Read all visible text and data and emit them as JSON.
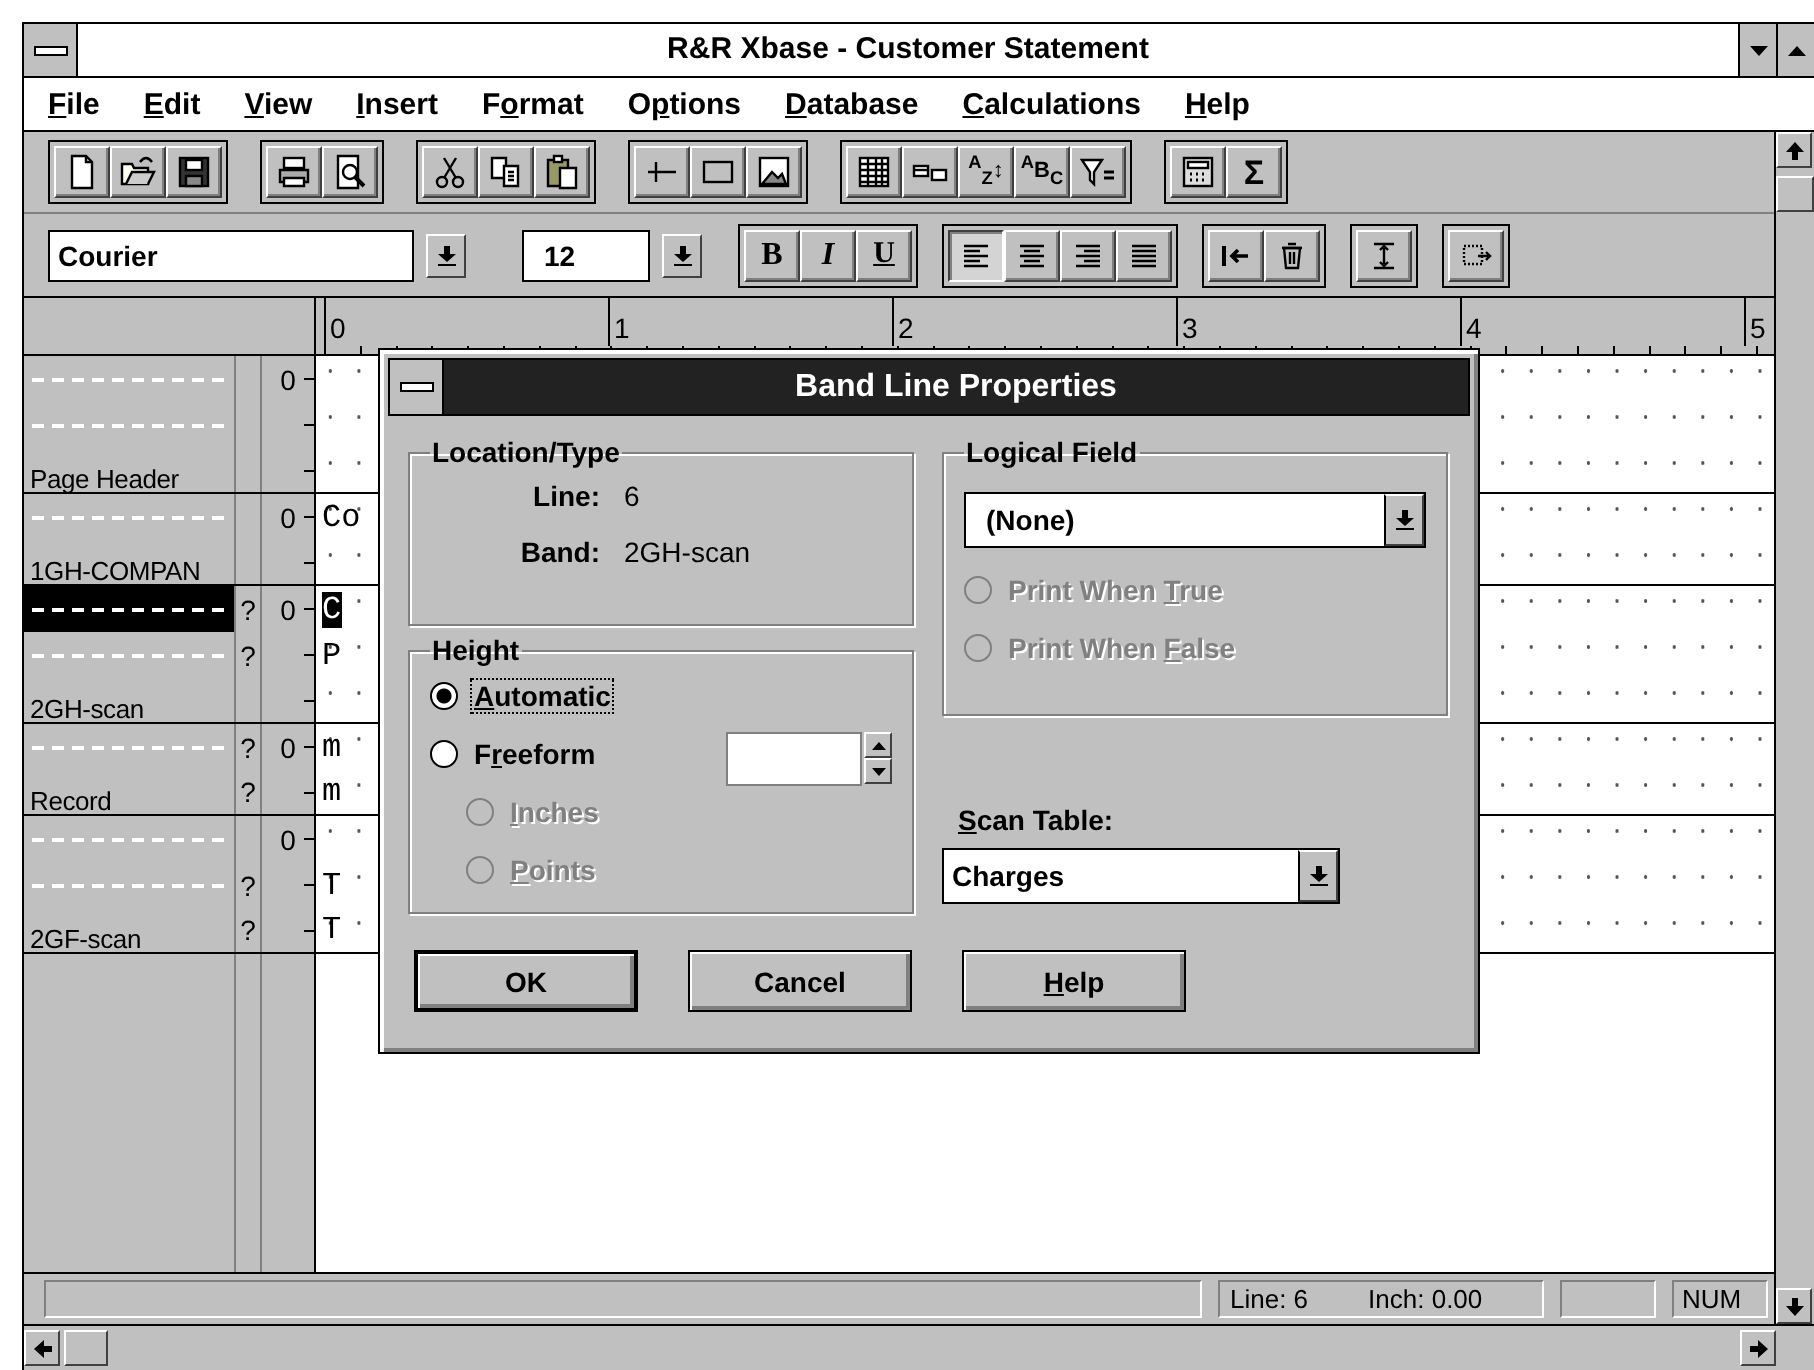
{
  "window": {
    "title": "R&R Xbase - Customer Statement"
  },
  "menu": [
    {
      "key": "F",
      "post": "ile"
    },
    {
      "key": "E",
      "post": "dit"
    },
    {
      "key": "V",
      "post": "iew"
    },
    {
      "key": "I",
      "post": "nsert"
    },
    {
      "pre": "F",
      "key": "o",
      "post": "rmat"
    },
    {
      "pre": "O",
      "key": "p",
      "post": "tions"
    },
    {
      "key": "D",
      "post": "atabase"
    },
    {
      "key": "C",
      "post": "alculations"
    },
    {
      "key": "H",
      "post": "elp"
    }
  ],
  "toolbar": [
    [
      {
        "kind": "new"
      },
      {
        "kind": "open"
      },
      {
        "kind": "save"
      }
    ],
    [
      {
        "kind": "print"
      },
      {
        "kind": "preview"
      }
    ],
    [
      {
        "kind": "cut"
      },
      {
        "kind": "copy"
      },
      {
        "kind": "paste"
      }
    ],
    [
      {
        "kind": "line"
      },
      {
        "kind": "rect"
      },
      {
        "kind": "image"
      }
    ],
    [
      {
        "kind": "table"
      },
      {
        "kind": "fields"
      },
      {
        "kind": "sort",
        "label": "$^{A}$$_{Z}$↕"
      },
      {
        "kind": "case",
        "label": "$^{A}$B$_{C}$"
      },
      {
        "kind": "filter"
      }
    ],
    [
      {
        "kind": "calc"
      },
      {
        "kind": "text",
        "label": "Σ"
      }
    ]
  ],
  "format_bar": {
    "font": "Courier",
    "size": "12",
    "groups": [
      [
        {
          "kind": "bold",
          "label": "B"
        },
        {
          "kind": "italic",
          "label": "I"
        },
        {
          "kind": "underline",
          "label": "U"
        }
      ],
      [
        {
          "kind": "align-left",
          "pressed": true
        },
        {
          "kind": "align-center",
          "pressed": false
        },
        {
          "kind": "align-right",
          "pressed": false
        },
        {
          "kind": "justify",
          "pressed": false
        }
      ],
      [
        {
          "kind": "indent"
        },
        {
          "kind": "trash"
        }
      ],
      [
        {
          "kind": "height"
        }
      ],
      [
        {
          "kind": "insert"
        }
      ]
    ]
  },
  "ruler": [
    "0",
    "1",
    "2",
    "3",
    "4",
    "5"
  ],
  "bands": [
    {
      "lines": [
        {
          "kind": "dash",
          "origin": "0",
          "selected": false
        },
        {
          "kind": "dash",
          "selected": false
        },
        {
          "kind": "label",
          "label": "Page Header",
          "selected": false
        }
      ]
    },
    {
      "lines": [
        {
          "kind": "dash",
          "origin": "0",
          "text": "Co",
          "selected": false
        },
        {
          "kind": "label",
          "label": "1GH-COMPAN",
          "selected": false
        }
      ]
    },
    {
      "lines": [
        {
          "kind": "dash",
          "mark": "?",
          "origin": "0",
          "text": "C",
          "selected": true
        },
        {
          "kind": "dash",
          "mark": "?",
          "text": "P",
          "selected": false
        },
        {
          "kind": "label",
          "label": "2GH-scan",
          "selected": false
        }
      ]
    },
    {
      "lines": [
        {
          "kind": "dash",
          "mark": "?",
          "origin": "0",
          "text": "m",
          "selected": false
        },
        {
          "kind": "label",
          "label": "Record",
          "mark": "?",
          "text": "m",
          "selected": false
        }
      ]
    },
    {
      "lines": [
        {
          "kind": "dash",
          "origin": "0",
          "selected": false
        },
        {
          "kind": "dash",
          "mark": "?",
          "text": "T",
          "selected": false
        },
        {
          "kind": "label",
          "label": "2GF-scan",
          "mark": "?",
          "text": "T",
          "selected": false
        }
      ]
    }
  ],
  "status_bar": {
    "position": [
      "Line: 6",
      "Inch: 0.00"
    ],
    "indicator": "NUM"
  },
  "dialog": {
    "title": "Band Line Properties",
    "location": {
      "title": "Location/Type",
      "rows": [
        {
          "label": "Line:",
          "value": "6"
        },
        {
          "label": "Band:",
          "value": "2GH-scan"
        }
      ]
    },
    "height": {
      "title": "Height",
      "options": [
        {
          "key": "A",
          "post": "utomatic",
          "selected": true,
          "disabled": false,
          "focused": true
        },
        {
          "pre": "F",
          "key": "r",
          "post": "eeform",
          "selected": false,
          "disabled": false,
          "focused": false,
          "children": [
            {
              "key": "I",
              "post": "nches",
              "selected": false,
              "disabled": true,
              "focused": false
            },
            {
              "key": "P",
              "post": "oints",
              "selected": false,
              "disabled": true,
              "focused": false
            }
          ]
        }
      ]
    },
    "logical": {
      "title": "Logical Field",
      "value": "(None)",
      "options": [
        {
          "pre": "Print When ",
          "key": "T",
          "post": "rue",
          "selected": false,
          "disabled": true,
          "focused": false
        },
        {
          "pre": "Print When ",
          "key": "F",
          "post": "alse",
          "selected": false,
          "disabled": true,
          "focused": false
        }
      ]
    },
    "scan": {
      "key": "S",
      "post": "can Table:",
      "value": "Charges"
    },
    "buttons": [
      {
        "pre": "OK",
        "default": true
      },
      {
        "pre": "Cancel",
        "default": false
      },
      {
        "key": "H",
        "post": "elp",
        "default": false
      }
    ]
  }
}
